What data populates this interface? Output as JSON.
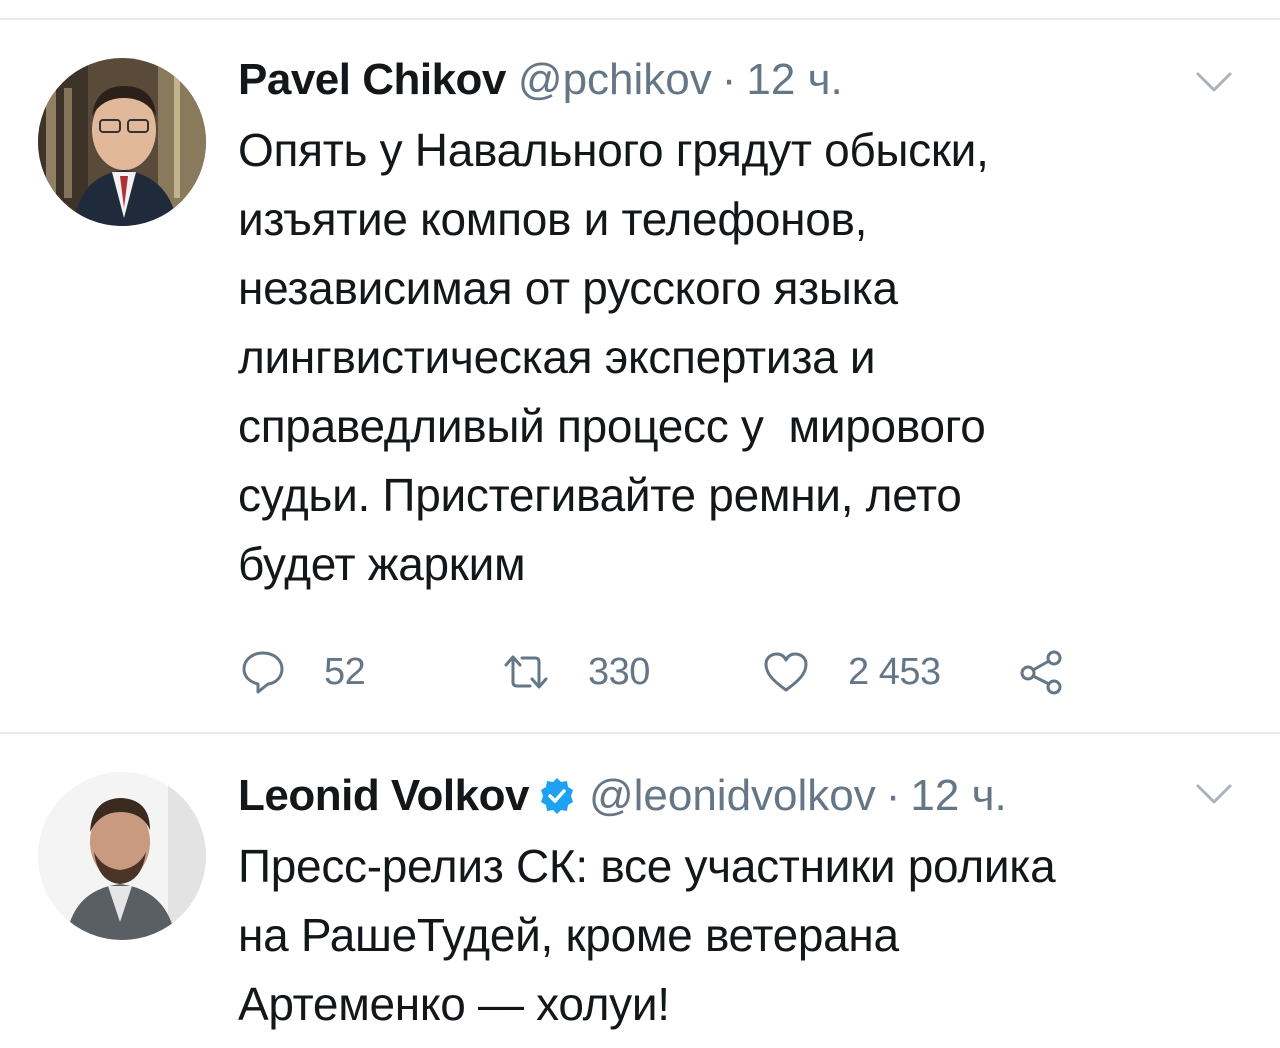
{
  "tweets": [
    {
      "name": "Pavel Chikov",
      "handle": "@pchikov",
      "separator": "·",
      "time": "12 ч.",
      "text": "Опять у Навального грядут обыски,\nизъятие компов и телефонов,\nнезависимая от русского языка\nлингвистическая экспертиза и\nсправедливый процесс у  мирового\nсудьи. Пристегивайте ремни, лето\nбудет жарким",
      "replies": "52",
      "retweets": "330",
      "likes": "2 453"
    },
    {
      "name": "Leonid Volkov",
      "handle": "@leonidvolkov",
      "separator": "·",
      "time": "12 ч.",
      "verified": true,
      "text": "Пресс-релиз СК: все участники ролика\nна РашеТудей, кроме ветерана\nАртеменко — холуи!"
    }
  ],
  "icons": {
    "reply": "reply-icon",
    "retweet": "retweet-icon",
    "like": "heart-icon",
    "share": "share-icon",
    "menu": "chevron-down-icon",
    "verified": "verified-badge-icon"
  },
  "colors": {
    "text": "#14171a",
    "secondary": "#657786",
    "divider": "#e6ecf0",
    "verified": "#1da1f2"
  }
}
